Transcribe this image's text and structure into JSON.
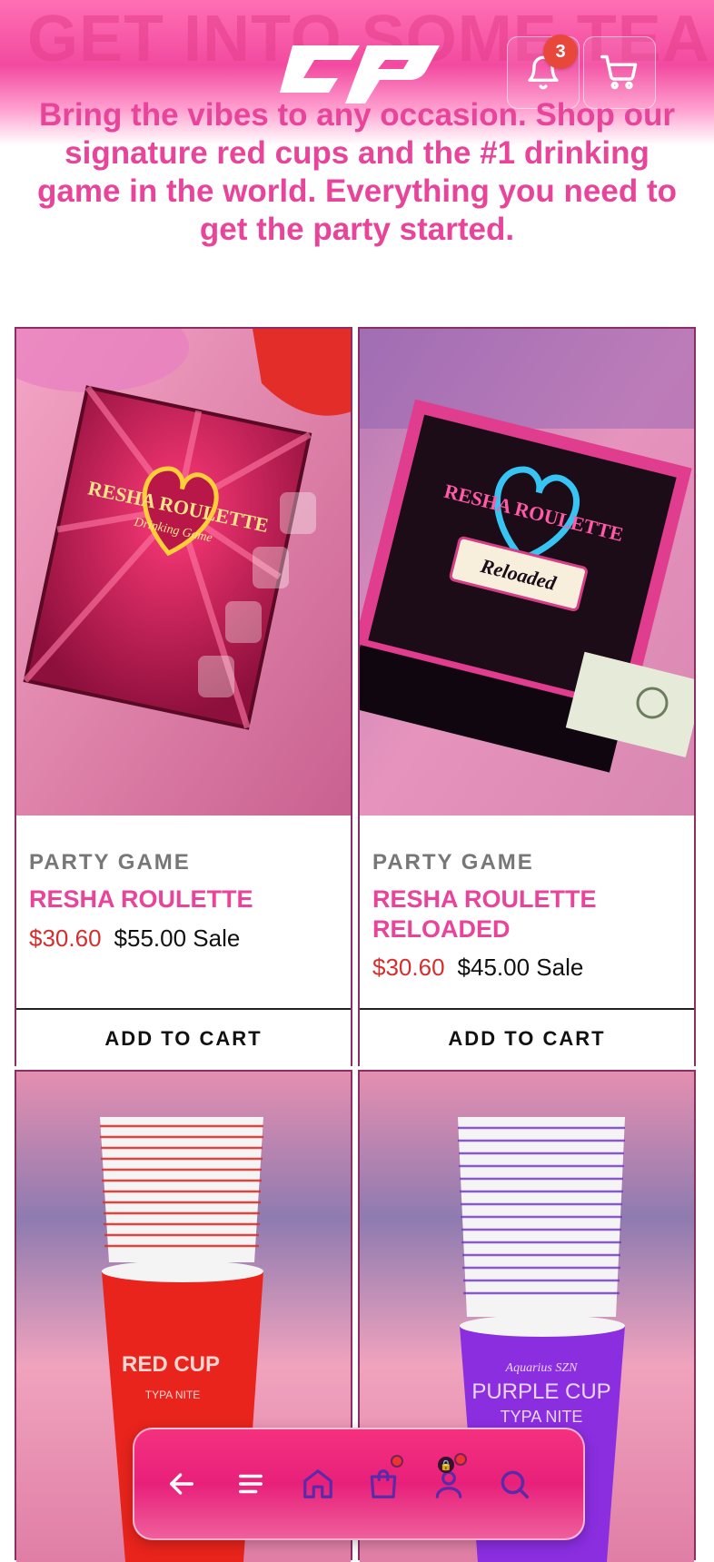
{
  "header": {
    "banner_text": "GET INTO SOME TEA!",
    "logo_icon": "cp-logo",
    "notifications": {
      "icon": "bell-icon",
      "count": "3"
    },
    "cart": {
      "icon": "cart-icon"
    }
  },
  "intro": {
    "text": "Bring the vibes to any occasion. Shop our signature red cups and the #1 drinking game in the world. Everything you need to get the party started."
  },
  "products": [
    {
      "category": "PARTY GAME",
      "title": "RESHA ROULETTE",
      "sale_price": "$30.60",
      "regular_price": "$55.00 Sale",
      "button": "ADD TO CART",
      "image_box_text": "RESHA ROULETTE",
      "image_sub_text": "Drinking Game"
    },
    {
      "category": "PARTY GAME",
      "title": "RESHA ROULETTE RELOADED",
      "sale_price": "$30.60",
      "regular_price": "$45.00 Sale",
      "button": "ADD TO CART",
      "image_box_text": "RESHA ROULETTE",
      "image_sub_text": "Reloaded"
    },
    {
      "image_cup_text": "RED CUP",
      "image_cup_sub": "TYPA NITE"
    },
    {
      "image_cup_text": "PURPLE CUP",
      "image_cup_sub": "TYPA NITE",
      "image_cup_top": "Aquarius SZN"
    }
  ],
  "bottom_nav": {
    "items": [
      "back-arrow-icon",
      "menu-icon",
      "home-icon",
      "bag-icon",
      "account-icon",
      "search-icon"
    ]
  },
  "colors": {
    "brand_pink": "#e8449a",
    "sale_red": "#d42f2f",
    "card_border": "#8a2e63",
    "nav_pink": "#f5317f"
  }
}
